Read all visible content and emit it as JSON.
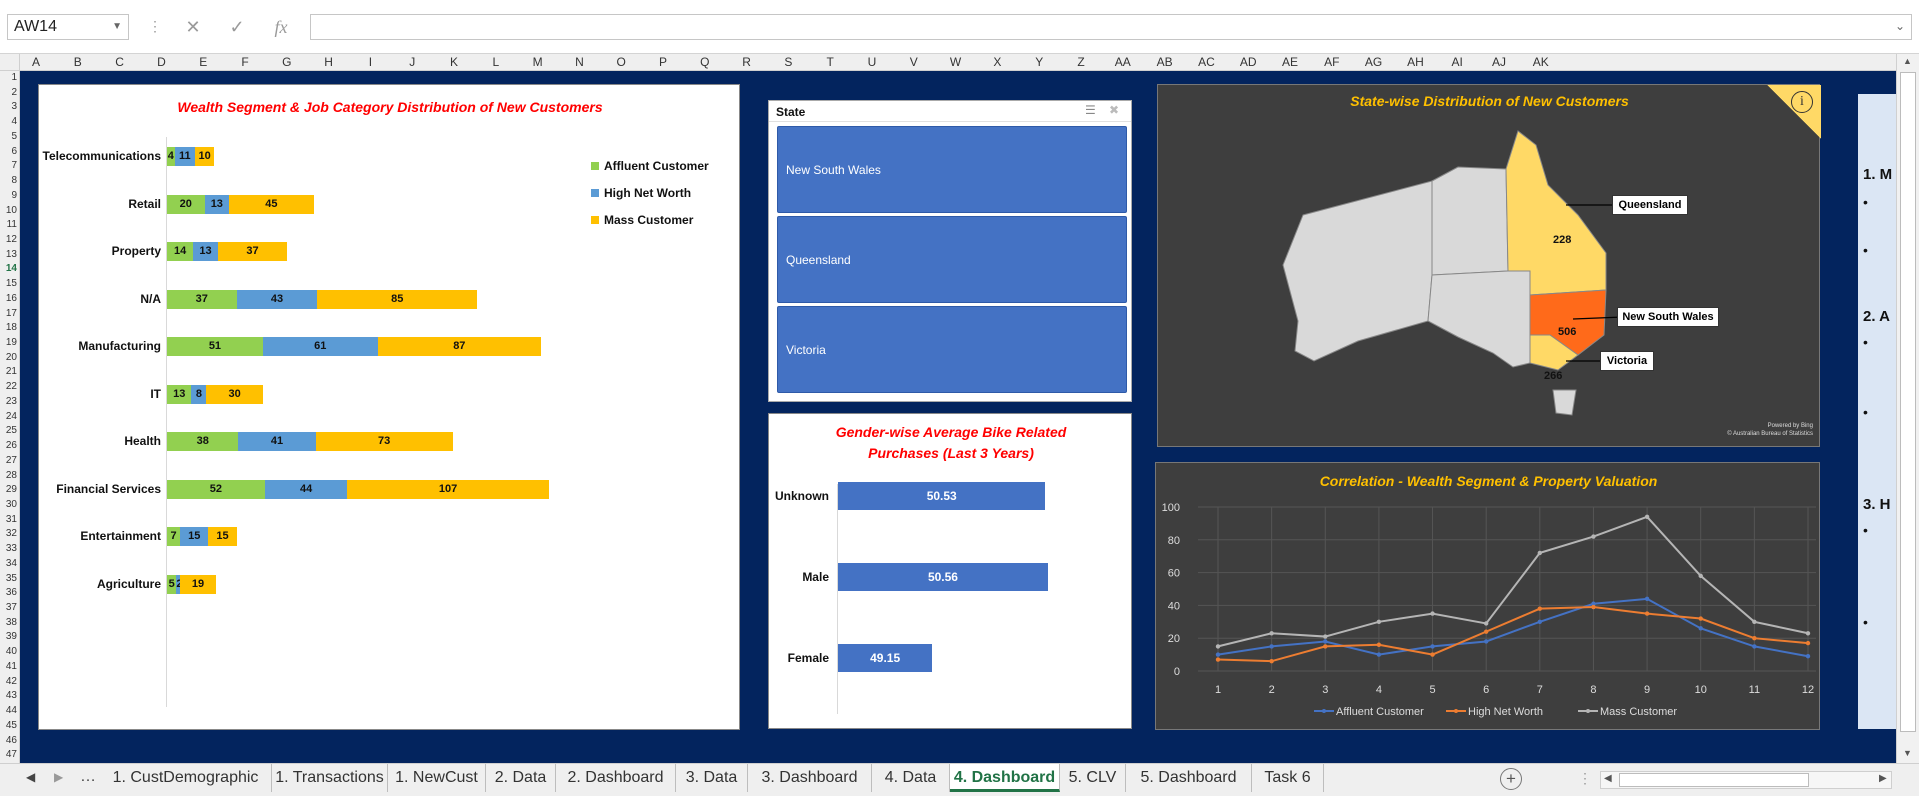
{
  "formula_bar": {
    "name_box": "AW14",
    "formula": ""
  },
  "columns": [
    "A",
    "B",
    "C",
    "D",
    "E",
    "F",
    "G",
    "H",
    "I",
    "J",
    "K",
    "L",
    "M",
    "N",
    "O",
    "P",
    "Q",
    "R",
    "S",
    "T",
    "U",
    "V",
    "W",
    "X",
    "Y",
    "Z",
    "AA",
    "AB",
    "AC",
    "AD",
    "AE",
    "AF",
    "AG",
    "AH",
    "AI",
    "AJ",
    "AK"
  ],
  "rows": [
    "1",
    "2",
    "3",
    "4",
    "5",
    "6",
    "7",
    "8",
    "9",
    "10",
    "11",
    "12",
    "13",
    "14",
    "15",
    "16",
    "17",
    "18",
    "19",
    "20",
    "21",
    "22",
    "23",
    "24",
    "25",
    "26",
    "27",
    "28",
    "29",
    "30",
    "31",
    "32",
    "33",
    "34",
    "35",
    "36",
    "37",
    "38",
    "39",
    "40",
    "41",
    "42",
    "43",
    "44",
    "45",
    "46",
    "47"
  ],
  "wealth_chart": {
    "title": "Wealth Segment & Job Category Distribution of New Customers"
  },
  "slicer": {
    "title": "State",
    "items": [
      "New South Wales",
      "Queensland",
      "Victoria"
    ]
  },
  "gender_chart": {
    "title": "Gender-wise Average Bike Related Purchases (Last 3 Years)",
    "title_line1": "Gender-wise Average Bike Related",
    "title_line2": "Purchases (Last 3 Years)"
  },
  "map_chart": {
    "title": "State-wise Distribution of New Customers",
    "labels": {
      "qld": "Queensland",
      "nsw": "New South Wales",
      "vic": "Victoria"
    },
    "values": {
      "qld": "228",
      "nsw": "506",
      "vic": "266"
    },
    "credit1": "Powered by Bing",
    "credit2": "© Australian Bureau of Statistics",
    "info_icon": "info-icon"
  },
  "corr_chart": {
    "title": "Correlation - Wealth Segment & Property Valuation"
  },
  "notes": {
    "lines": [
      "1. M",
      "2. A",
      "3. H"
    ]
  },
  "colors": {
    "affluent": "#92d050",
    "hnw": "#5b9bd5",
    "mass": "#ffc000",
    "title_red": "#ff0000",
    "title_gold": "#ffc000",
    "sheet_bg": "#03245e",
    "nsw": "#ff6a1a",
    "qld_vic": "#ffd966"
  },
  "sheet_tabs": [
    "1. CustDemographic",
    "1. Transactions",
    "1. NewCust",
    "2. Data",
    "2. Dashboard",
    "3. Data",
    "3. Dashboard",
    "4. Data",
    "4. Dashboard",
    "5. CLV",
    "5. Dashboard",
    "Task 6"
  ],
  "active_tab": "4. Dashboard",
  "chart_data": [
    {
      "type": "bar",
      "orientation": "horizontal",
      "stacked": true,
      "categories": [
        "Telecommunications",
        "Retail",
        "Property",
        "N/A",
        "Manufacturing",
        "IT",
        "Health",
        "Financial Services",
        "Entertainment",
        "Agriculture"
      ],
      "series": [
        {
          "name": "Affluent Customer",
          "values": [
            4,
            20,
            14,
            37,
            51,
            13,
            38,
            52,
            7,
            5
          ]
        },
        {
          "name": "High Net Worth",
          "values": [
            11,
            13,
            13,
            43,
            61,
            8,
            41,
            44,
            15,
            2
          ]
        },
        {
          "name": "Mass Customer",
          "values": [
            10,
            45,
            37,
            85,
            87,
            30,
            73,
            107,
            15,
            19
          ]
        }
      ],
      "legend": "right"
    },
    {
      "type": "bar",
      "orientation": "horizontal",
      "categories": [
        "Unknown",
        "Male",
        "Female"
      ],
      "values": [
        50.53,
        50.56,
        49.15
      ],
      "xlim": [
        48,
        51
      ]
    },
    {
      "type": "line",
      "x": [
        1,
        2,
        3,
        4,
        5,
        6,
        7,
        8,
        9,
        10,
        11,
        12
      ],
      "series": [
        {
          "name": "Affluent Customer",
          "values": [
            10,
            15,
            18,
            10,
            15,
            18,
            30,
            41,
            44,
            26,
            15,
            9
          ]
        },
        {
          "name": "High Net Worth",
          "values": [
            7,
            6,
            15,
            16,
            10,
            24,
            38,
            39,
            35,
            32,
            20,
            17
          ]
        },
        {
          "name": "Mass Customer",
          "values": [
            15,
            23,
            21,
            30,
            35,
            29,
            72,
            82,
            94,
            58,
            30,
            23
          ]
        }
      ],
      "ylim": [
        0,
        100
      ],
      "yticks": [
        "0",
        "20",
        "40",
        "60",
        "80",
        "100"
      ],
      "grid": true,
      "legend": "bottom"
    }
  ]
}
